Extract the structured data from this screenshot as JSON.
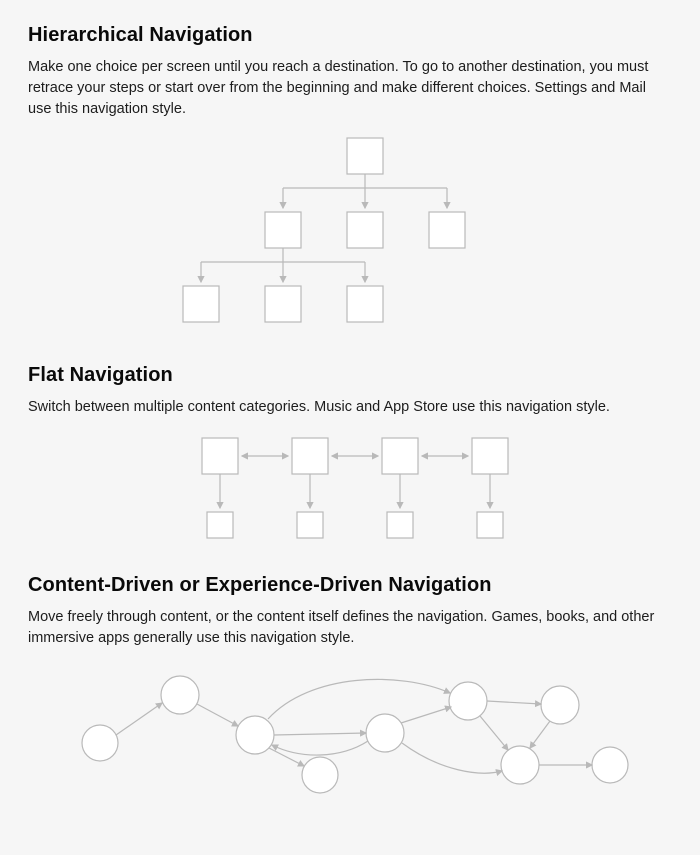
{
  "sections": [
    {
      "title": "Hierarchical Navigation",
      "body": "Make one choice per screen until you reach a destination. To go to another destination, you must retrace your steps or start over from the beginning and make different choices. Settings and Mail use this navigation style."
    },
    {
      "title": "Flat Navigation",
      "body": "Switch between multiple content categories. Music and App Store use this navigation style."
    },
    {
      "title": "Content-Driven or Experience-Driven Navigation",
      "body": "Move freely through content, or the content itself defines the navigation. Games, books, and other immersive apps generally use this navigation style."
    }
  ]
}
